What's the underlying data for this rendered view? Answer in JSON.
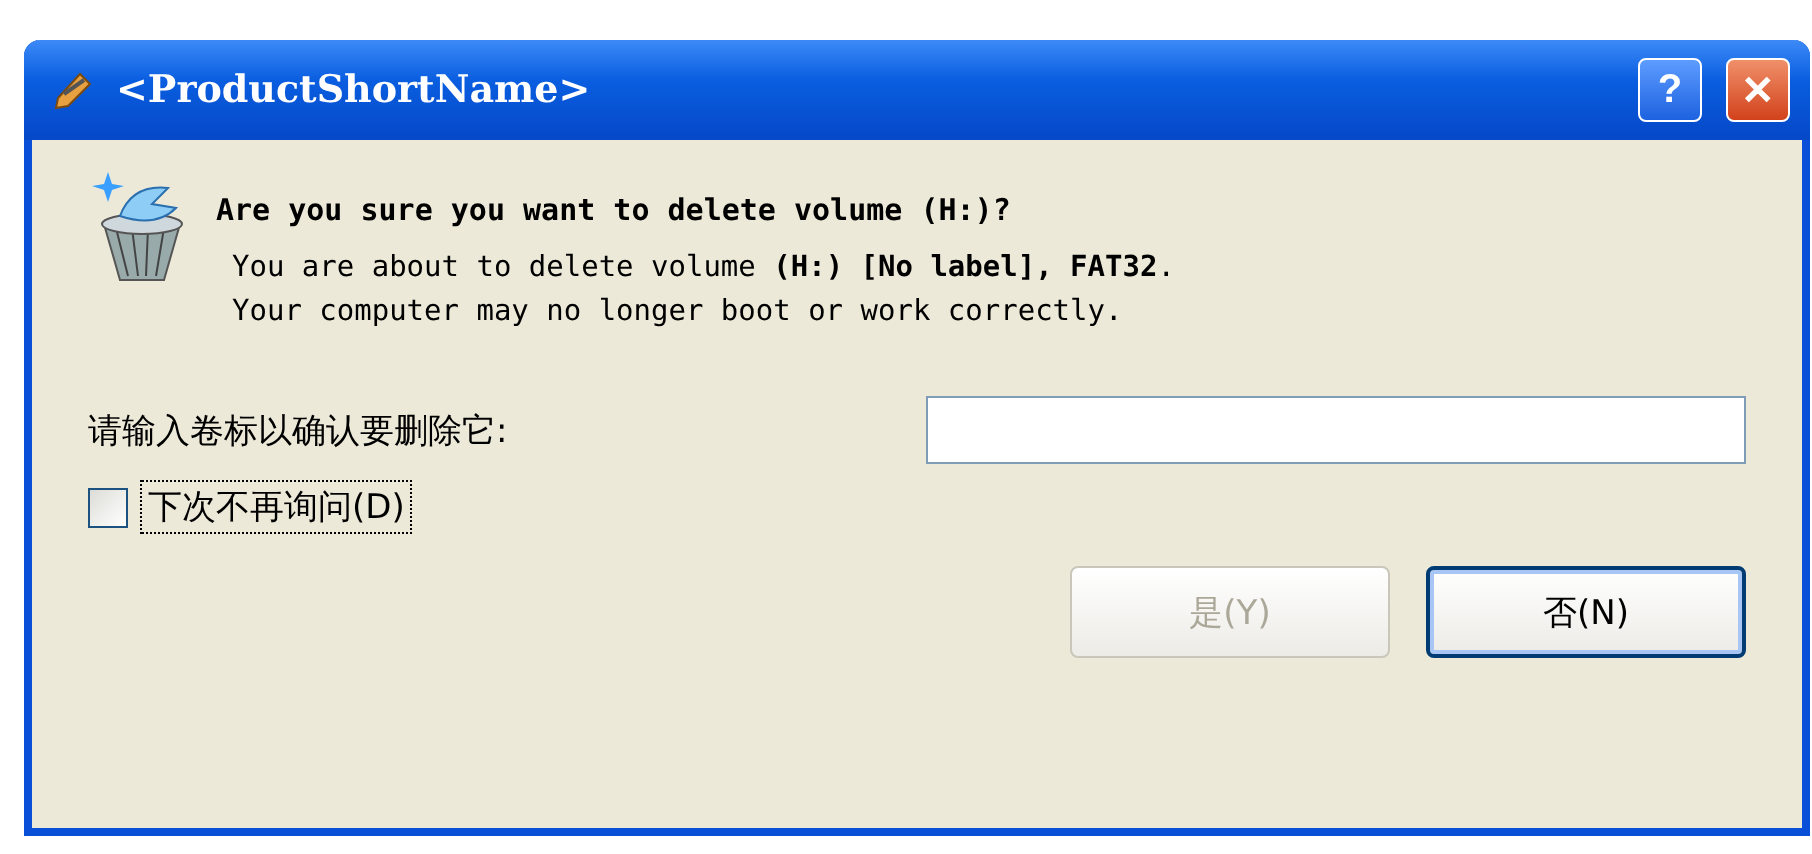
{
  "window": {
    "title": "<ProductShortName>"
  },
  "title_buttons": [
    {
      "kind": "help",
      "label": "?"
    },
    {
      "kind": "close",
      "label": "✕"
    }
  ],
  "message": {
    "heading": "Are you sure you want to delete volume (H:)?",
    "lines": [
      "You are about to delete volume **(H:) [No label], FAT32**.",
      "Your computer may no longer boot or work correctly."
    ]
  },
  "confirm_field": {
    "label": "请输入卷标以确认要删除它:"
  },
  "dont_ask": {
    "label": "下次不再询问(D)",
    "checked": false
  },
  "buttons": [
    {
      "label": "是(Y)",
      "disabled": true,
      "default": false
    },
    {
      "label": "否(N)",
      "disabled": false,
      "default": true
    }
  ]
}
